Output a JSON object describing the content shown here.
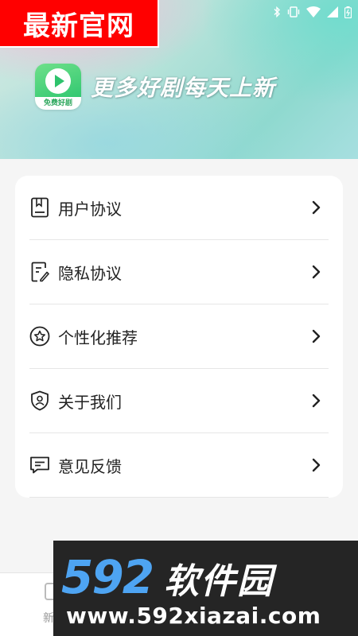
{
  "status_bar": {
    "icons": [
      "bluetooth-icon",
      "vibrate-icon",
      "wifi-icon",
      "signal-icon",
      "battery-icon"
    ]
  },
  "header": {
    "logo_caption": "免费好剧",
    "slogan": "更多好剧每天上新"
  },
  "menu": {
    "items": [
      {
        "icon": "document-icon",
        "label": "用户协议"
      },
      {
        "icon": "edit-document-icon",
        "label": "隐私协议"
      },
      {
        "icon": "star-icon",
        "label": "个性化推荐"
      },
      {
        "icon": "shield-user-icon",
        "label": "关于我们"
      },
      {
        "icon": "feedback-icon",
        "label": "意见反馈"
      }
    ]
  },
  "bottom_nav": {
    "items": [
      {
        "label": "新"
      }
    ]
  },
  "watermarks": {
    "top_left": "最新官网",
    "brand_number": "592",
    "brand_text": "软件园",
    "url": "www.592xiazai.com"
  },
  "colors": {
    "accent_green": "#23c26b",
    "watermark_red": "#ff0000",
    "watermark_blue": "#4ea4f2",
    "card_background": "#ffffff",
    "page_background": "#f5f5f5"
  }
}
